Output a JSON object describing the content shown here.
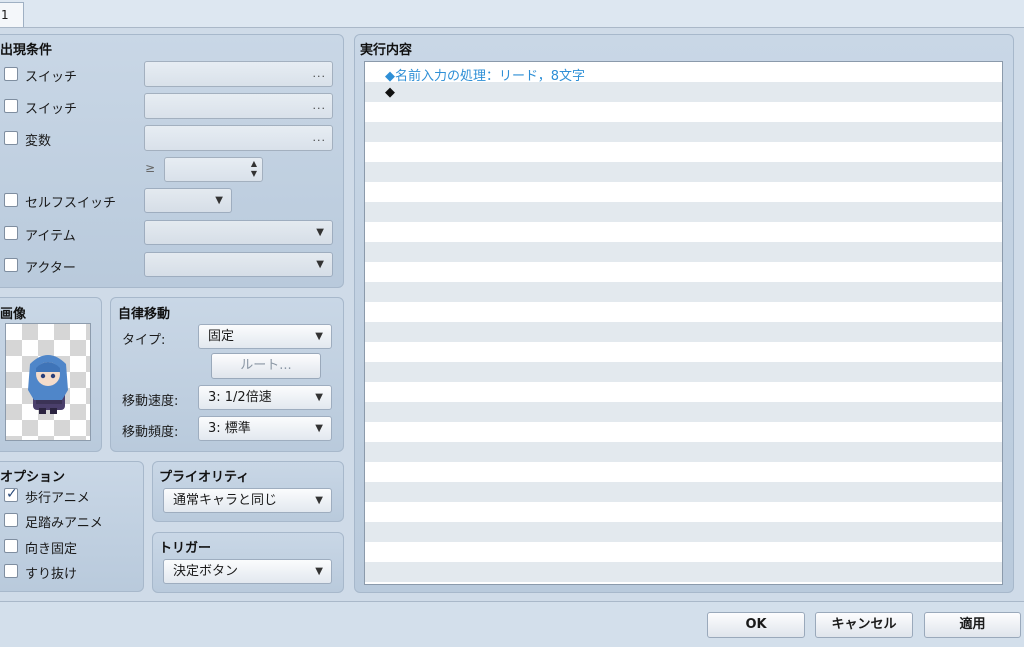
{
  "tab": {
    "label": "1"
  },
  "conditions": {
    "title": "出現条件",
    "switch1": {
      "label": "スイッチ",
      "button": "..."
    },
    "switch2": {
      "label": "スイッチ",
      "button": "..."
    },
    "variable": {
      "label": "変数",
      "button": "...",
      "compare": "≥"
    },
    "self_switch": {
      "label": "セルフスイッチ"
    },
    "item": {
      "label": "アイテム"
    },
    "actor": {
      "label": "アクター"
    }
  },
  "image": {
    "title": "画像"
  },
  "autonomous": {
    "title": "自律移動",
    "type_label": "タイプ:",
    "type_value": "固定",
    "route_button": "ルート...",
    "speed_label": "移動速度:",
    "speed_value": "3: 1/2倍速",
    "freq_label": "移動頻度:",
    "freq_value": "3: 標準"
  },
  "options": {
    "title": "オプション",
    "walking": {
      "label": "歩行アニメ",
      "checked": true
    },
    "stepping": {
      "label": "足踏みアニメ",
      "checked": false
    },
    "direction_fix": {
      "label": "向き固定",
      "checked": false
    },
    "through": {
      "label": "すり抜け",
      "checked": false
    }
  },
  "priority": {
    "title": "プライオリティ",
    "value": "通常キャラと同じ"
  },
  "trigger": {
    "title": "トリガー",
    "value": "決定ボタン"
  },
  "contents": {
    "title": "実行内容",
    "commands": [
      {
        "text": "◆名前入力の処理：リード，8文字",
        "color": "#2e8fd6"
      },
      {
        "text": "◆",
        "color": "#111111"
      }
    ]
  },
  "footer": {
    "ok": "OK",
    "cancel": "キャンセル",
    "apply": "適用"
  },
  "icons": {
    "dropdown": "▼",
    "spinner_up": "▲",
    "spinner_down": "▼"
  }
}
